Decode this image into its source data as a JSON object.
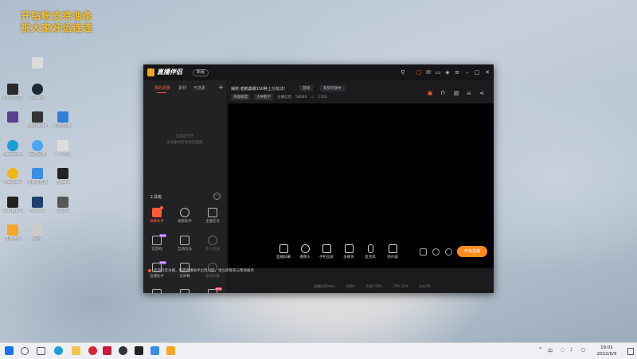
{
  "overlay": {
    "line1": "开钻粉支持油条",
    "line2": "祝大家好运连连"
  },
  "desktop_icons": [
    {
      "label": "",
      "color": "#dddddd"
    },
    {
      "label": "Wirl 5002",
      "color": "#2a2a2a"
    },
    {
      "label": "Steam",
      "color": "#1b2838"
    },
    {
      "label": "",
      "color": "#5a3f8a"
    },
    {
      "label": "Wallpaper Engine",
      "color": "#333333"
    },
    {
      "label": "控制面板",
      "color": "#2f7fd6"
    },
    {
      "label": "Microsoft Edge",
      "color": "#1a9fd8"
    },
    {
      "label": "百度网盘",
      "color": "#4aa3f5"
    },
    {
      "label": "个人中心",
      "color": "#dddddd"
    },
    {
      "label": "WeGame",
      "color": "#f3b418"
    },
    {
      "label": "谷歌浏览器",
      "color": "#3a8ee6"
    },
    {
      "label": "Typora",
      "color": "#222222"
    },
    {
      "label": "Stardew Valley",
      "color": "#222222"
    },
    {
      "label": "ShareX",
      "color": "#1c3f6e"
    },
    {
      "label": "Gacha",
      "color": "#555555"
    },
    {
      "label": "直播伴侣",
      "color": "#f5a623"
    },
    {
      "label": "图片",
      "color": "#cccccc"
    }
  ],
  "window": {
    "app_name": "直播伴侣",
    "version_badge": "新版",
    "title_icons": [
      "microphone-icon",
      "message-icon",
      "mail-icon",
      "screen-icon",
      "gift-icon",
      "menu-icon",
      "minimize-icon",
      "maximize-icon",
      "close-icon"
    ]
  },
  "sidebar": {
    "tabs": [
      "我的场景",
      "素材",
      "可选素"
    ],
    "add_label": "+",
    "empty_hint_1": "这里是空的",
    "empty_hint_2": "添加素材开始你的直播",
    "toolbox_title": "工具箱",
    "more_label": "···",
    "tools": [
      {
        "label": "弹幕助手",
        "active": true,
        "badge": "dot",
        "disabled": false
      },
      {
        "label": "观看助手",
        "active": false,
        "badge": "",
        "disabled": false
      },
      {
        "label": "主播任务",
        "active": false,
        "badge": "",
        "disabled": false
      },
      {
        "label": "玩游戏",
        "active": false,
        "badge": "NEW",
        "disabled": false
      },
      {
        "label": "互动玩法",
        "active": false,
        "badge": "",
        "disabled": false
      },
      {
        "label": "多人连线",
        "active": false,
        "badge": "",
        "disabled": true
      },
      {
        "label": "直播助手",
        "active": false,
        "badge": "NEW",
        "disabled": false
      },
      {
        "label": "读弹幕",
        "active": false,
        "badge": "",
        "disabled": false
      },
      {
        "label": "虚拟形象",
        "active": false,
        "badge": "",
        "disabled": true
      },
      {
        "label": "",
        "active": false,
        "badge": "",
        "disabled": false
      },
      {
        "label": "",
        "active": false,
        "badge": "",
        "disabled": false
      },
      {
        "label": "",
        "active": false,
        "badge": "NEW",
        "disabled": false
      }
    ]
  },
  "room": {
    "title": "抽奖:老鹅鼎踢150种上分玩法!",
    "category_chip": "游戏",
    "tag_chip": "有奖开放中",
    "info_chip_1": "英雄联盟",
    "info_chip_2": "大神教学",
    "followers_label": "主播信息",
    "followers_value": "58040",
    "fire_value": "1352",
    "header_icons": [
      "gift-box-icon",
      "lock-icon",
      "screen-record-icon",
      "bell-icon",
      "share-icon"
    ]
  },
  "controls": [
    {
      "label": "直播屏幕",
      "name": "screen-share"
    },
    {
      "label": "摄像头",
      "name": "camera"
    },
    {
      "label": "手机投屏",
      "name": "phone-cast"
    },
    {
      "label": "多媒体",
      "name": "multimedia"
    },
    {
      "label": "麦克风",
      "name": "microphone"
    },
    {
      "label": "扬声器",
      "name": "speaker"
    }
  ],
  "start_button": "开始直播",
  "notice": "欢迎抖音主播，如遇直播助手出现问题，请立即联系与帮助服务",
  "status": [
    "直播码率0kb/s",
    "帧率0",
    "丢帧0.00%",
    "CPU 12%",
    "内存0%"
  ],
  "taskbar": {
    "items": [
      {
        "name": "start-icon",
        "color": "#1a73e8"
      },
      {
        "name": "search-icon",
        "color": "#555555"
      },
      {
        "name": "task-view-icon",
        "color": "#555555"
      },
      {
        "name": "edge-icon",
        "color": "#1a9fd8"
      },
      {
        "name": "file-explorer-icon",
        "color": "#f2c14e"
      },
      {
        "name": "netease-icon",
        "color": "#d8263a"
      },
      {
        "name": "store-icon",
        "color": "#c91a3c"
      },
      {
        "name": "app-icon",
        "color": "#333333"
      },
      {
        "name": "obs-icon",
        "color": "#222222"
      },
      {
        "name": "chrome-icon",
        "color": "#3a8ee6"
      },
      {
        "name": "live-companion-icon",
        "color": "#f5a623"
      }
    ],
    "tray": [
      "^",
      "中",
      "◌",
      "♪",
      "◻"
    ],
    "time": "19:01",
    "date": "2022/6/9"
  }
}
